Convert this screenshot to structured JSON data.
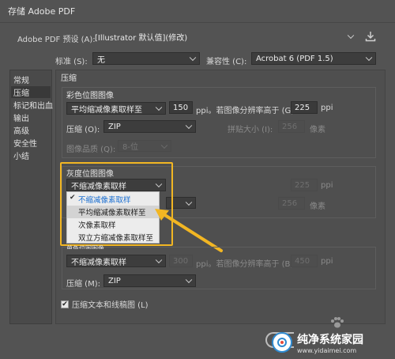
{
  "window": {
    "title": "存储 Adobe PDF"
  },
  "preset": {
    "label": "Adobe PDF 预设 (A):",
    "value": "[Illustrator 默认值](修改)"
  },
  "standard": {
    "label": "标准 (S):",
    "value": "无"
  },
  "compat": {
    "label": "兼容性 (C):",
    "value": "Acrobat 6 (PDF 1.5)"
  },
  "sidebar": {
    "items": [
      {
        "label": "常规"
      },
      {
        "label": "压缩"
      },
      {
        "label": "标记和出血"
      },
      {
        "label": "输出"
      },
      {
        "label": "高级"
      },
      {
        "label": "安全性"
      },
      {
        "label": "小结"
      }
    ]
  },
  "compression": {
    "heading": "压缩",
    "color": {
      "heading": "彩色位图图像",
      "downsample": "平均缩减像素取样至",
      "ppi_value": "150",
      "ppi_unit": "ppi。若图像分辨率高于 (G)",
      "above_value": "225",
      "above_unit": "ppi",
      "compression_label": "压缩 (O):",
      "compression_value": "ZIP",
      "tile_label": "拼贴大小 (I):",
      "tile_value": "256",
      "tile_unit": "像素",
      "quality_label": "图像品质 (Q):",
      "quality_value": "8-位"
    },
    "gray": {
      "heading": "灰度位图图像",
      "downsample": "不缩减像素取样",
      "above_value": "225",
      "above_unit": "ppi",
      "tile_value": "256",
      "tile_unit": "像素",
      "menu": [
        {
          "label": "不缩减像素取样"
        },
        {
          "label": "平均缩减像素取样至"
        },
        {
          "label": "次像素取样"
        },
        {
          "label": "双立方缩减像素取样至"
        }
      ]
    },
    "mono": {
      "heading": "单色位图图像",
      "downsample": "不缩减像素取样",
      "ppi_value": "300",
      "ppi_unit": "ppi。若图像分辨率高于 (B)",
      "above_value": "450",
      "above_unit": "ppi",
      "compression_label": "压缩 (M):",
      "compression_value": "ZIP"
    },
    "compress_text": {
      "label": "压缩文本和线稿图 (L)",
      "checked": true
    }
  },
  "watermark": {
    "cn": "纯净系统家园",
    "en": "www.yidaimei.com"
  }
}
